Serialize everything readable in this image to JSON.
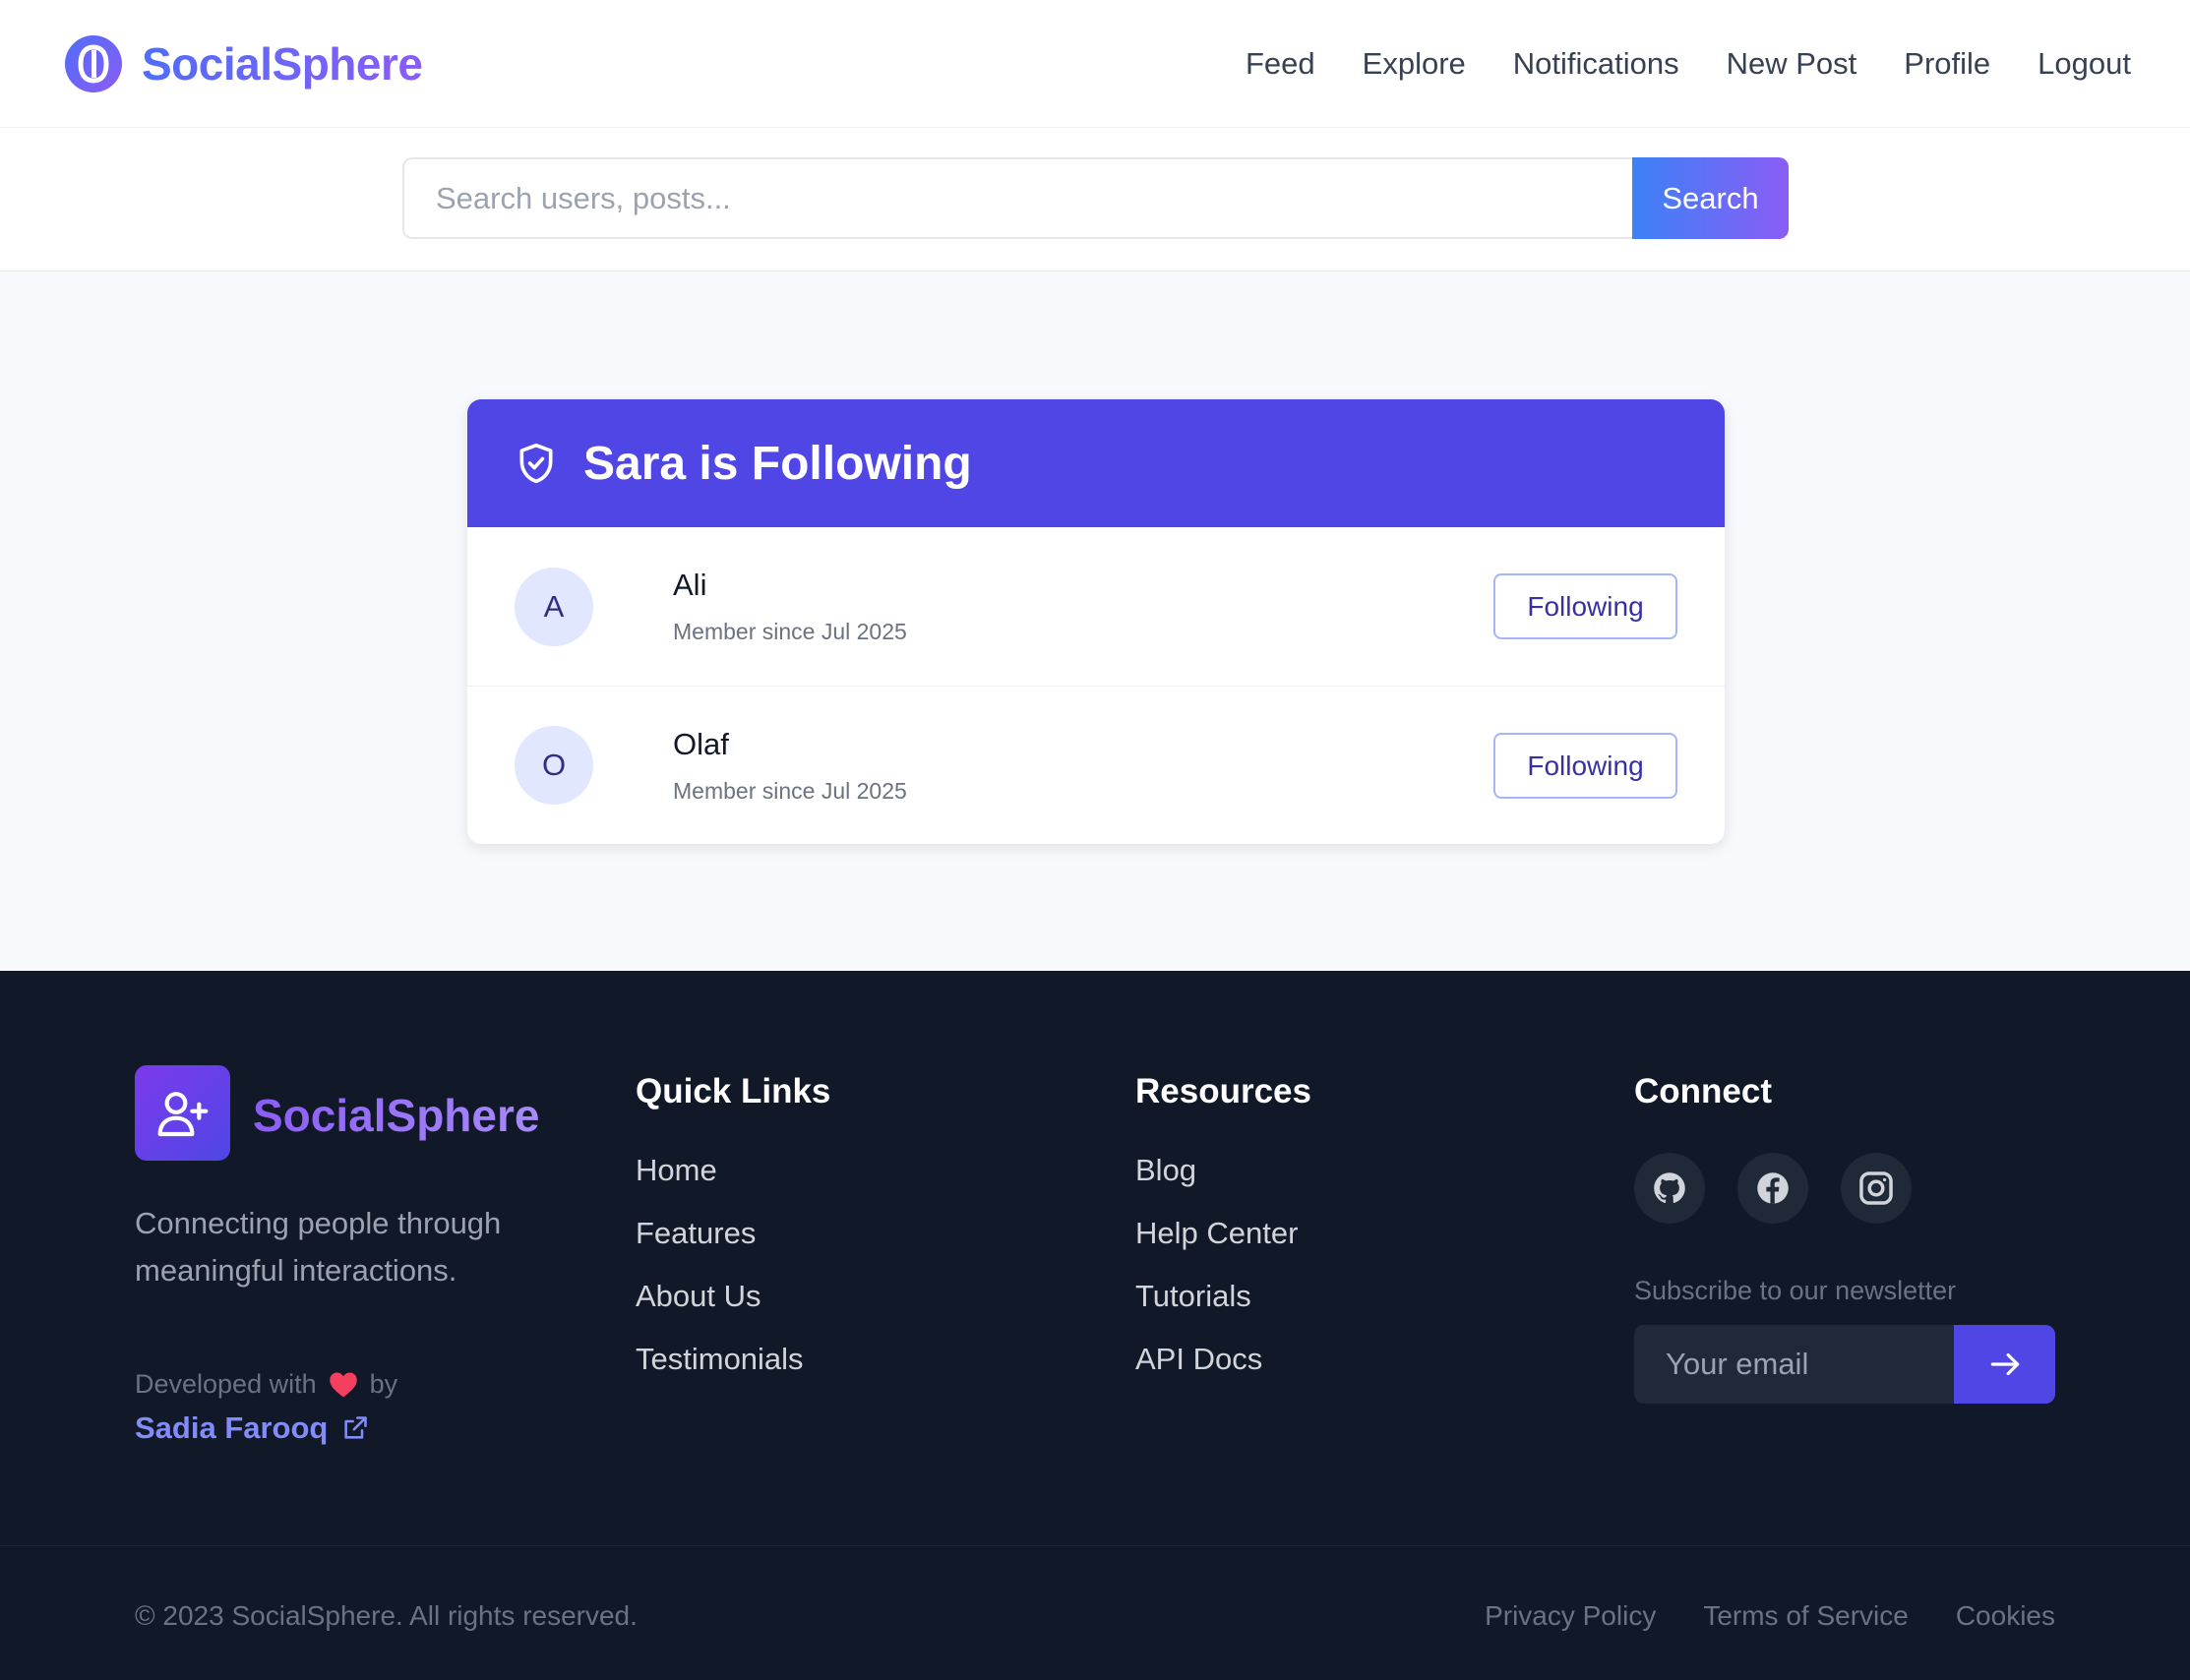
{
  "navbar": {
    "brand": "SocialSphere",
    "links": [
      "Feed",
      "Explore",
      "Notifications",
      "New Post",
      "Profile",
      "Logout"
    ]
  },
  "search": {
    "placeholder": "Search users, posts...",
    "button_label": "Search"
  },
  "following": {
    "title": "Sara is Following",
    "title_icon": "shield-check-icon",
    "users": [
      {
        "initial": "A",
        "name": "Ali",
        "since": "Member since Jul 2025",
        "button": "Following"
      },
      {
        "initial": "O",
        "name": "Olaf",
        "since": "Member since Jul 2025",
        "button": "Following"
      }
    ]
  },
  "footer": {
    "brand": "SocialSphere",
    "logo_icon": "user-plus-icon",
    "tagline": "Connecting people through meaningful interactions.",
    "developed_with": "Developed with",
    "by": "by",
    "developer": "Sadia Farooq",
    "quick_links": {
      "title": "Quick Links",
      "items": [
        "Home",
        "Features",
        "About Us",
        "Testimonials"
      ]
    },
    "resources": {
      "title": "Resources",
      "items": [
        "Blog",
        "Help Center",
        "Tutorials",
        "API Docs"
      ]
    },
    "connect": {
      "title": "Connect",
      "socials": [
        "github-icon",
        "facebook-icon",
        "instagram-icon"
      ],
      "newsletter_label": "Subscribe to our newsletter",
      "email_placeholder": "Your email"
    },
    "copyright": "© 2023 SocialSphere. All rights reserved.",
    "legal": [
      "Privacy Policy",
      "Terms of Service",
      "Cookies"
    ]
  },
  "colors": {
    "primary": "#4f46e5",
    "gradient_start": "#3b82f6",
    "gradient_end": "#8b5cf6",
    "footer_bg": "#111827"
  }
}
